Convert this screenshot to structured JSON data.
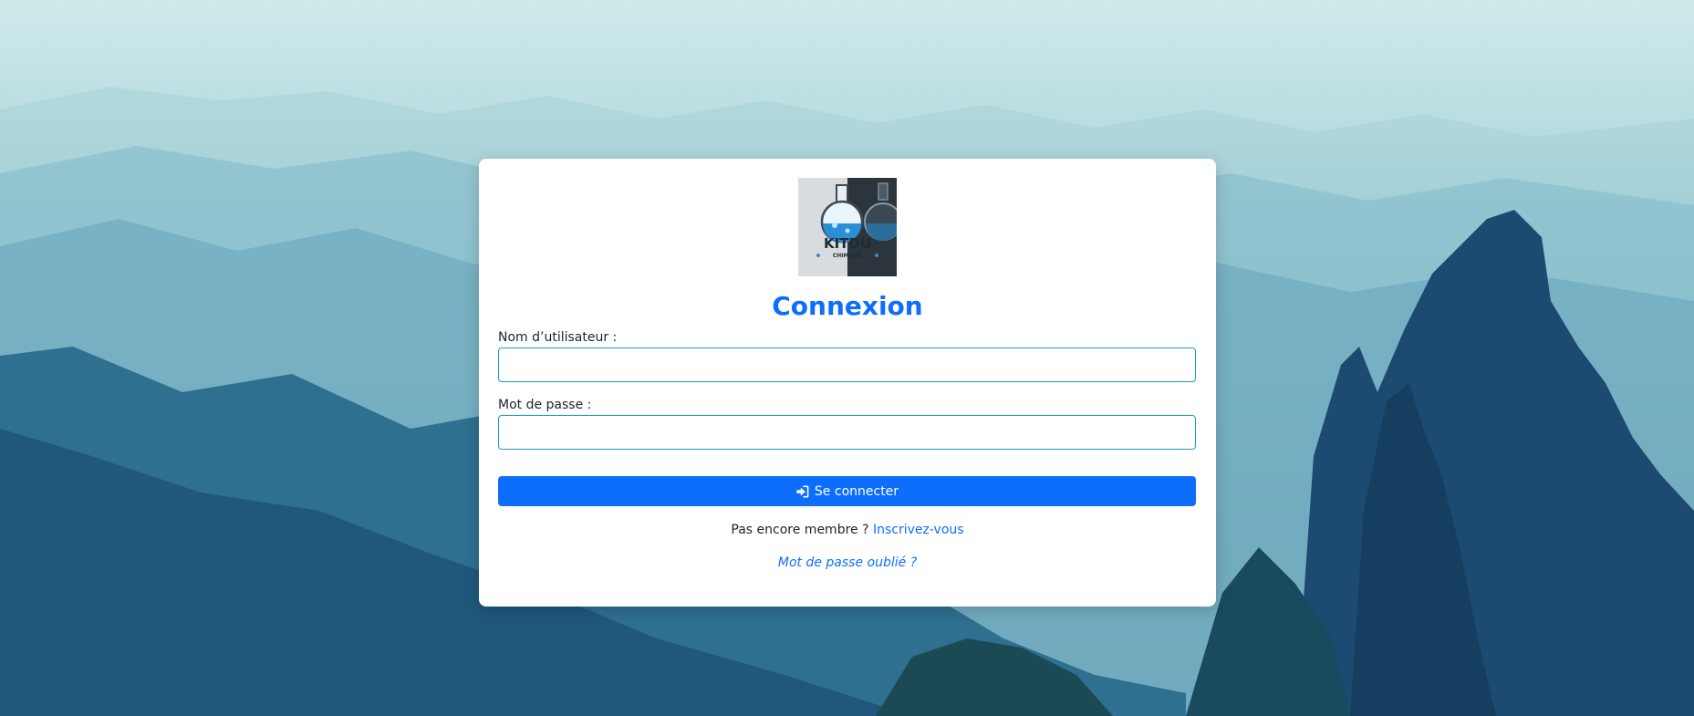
{
  "logo": {
    "text_line1": "KITDU",
    "text_line2": "CHIMISTE"
  },
  "form": {
    "title": "Connexion",
    "username_label": "Nom d’utilisateur :",
    "username_value": "",
    "password_label": "Mot de passe :",
    "password_value": "",
    "submit_label": "Se connecter",
    "submit_icon": "sign-in-icon"
  },
  "footer": {
    "register_prompt": "Pas encore membre ?",
    "register_link": "Inscrivez-vous",
    "forgot_link": "Mot de passe oublié ?"
  },
  "colors": {
    "accent": "#0d6efd",
    "input_border": "#17a2b8"
  }
}
